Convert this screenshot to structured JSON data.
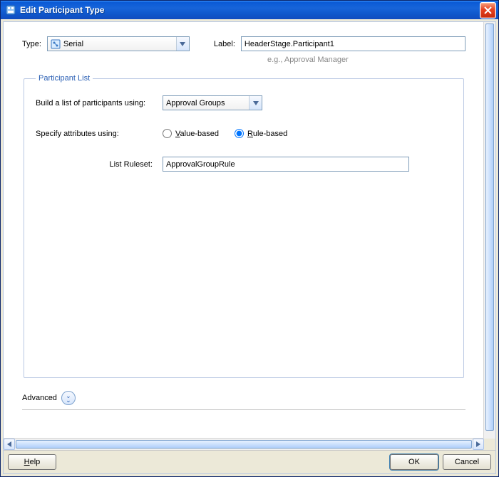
{
  "window": {
    "title": "Edit Participant Type"
  },
  "form": {
    "type_label": "Type:",
    "type_value": "Serial",
    "label_label": "Label:",
    "label_value": "HeaderStage.Participant1",
    "label_hint": "e.g., Approval Manager"
  },
  "participant_list": {
    "legend": "Participant List",
    "build_label": "Build a list of participants using:",
    "build_value": "Approval Groups",
    "attrs_label": "Specify attributes using:",
    "value_based_prefix": "V",
    "value_based_rest": "alue-based",
    "rule_based_prefix": "R",
    "rule_based_rest": "ule-based",
    "selected": "rule",
    "ruleset_label": "List Ruleset:",
    "ruleset_value": "ApprovalGroupRule"
  },
  "advanced": {
    "label": "Advanced"
  },
  "buttons": {
    "help_prefix": "H",
    "help_rest": "elp",
    "ok": "OK",
    "cancel": "Cancel"
  }
}
